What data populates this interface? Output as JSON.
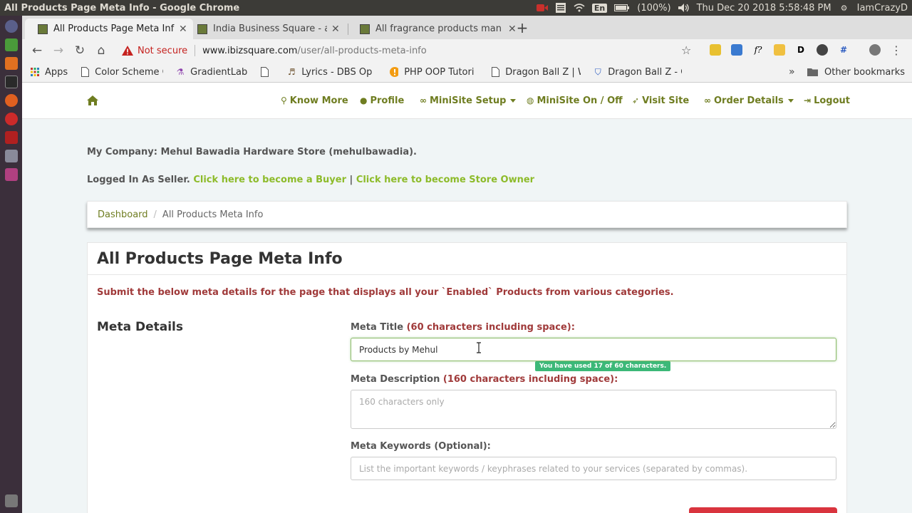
{
  "os_bar": {
    "window_title": "All Products Page Meta Info - Google Chrome",
    "battery": "(100%)",
    "lang": "En",
    "datetime": "Thu Dec 20 2018  5:58:48 PM",
    "user": "IamCrazyD"
  },
  "tabs": [
    {
      "label": "All Products Page Meta Inf",
      "active": true
    },
    {
      "label": "India Business Square - a",
      "active": false
    },
    {
      "label": "All fragrance products man",
      "active": false
    }
  ],
  "address": {
    "security": "Not secure",
    "host": "www.ibizsquare.com",
    "path": "/user/all-products-meta-info"
  },
  "bookmarks": {
    "items": [
      {
        "label": "Apps",
        "icon": "apps-grid-icon"
      },
      {
        "label": "Color Scheme G",
        "icon": "page-icon"
      },
      {
        "label": "GradientLab",
        "icon": "flask-icon"
      },
      {
        "label": "",
        "icon": "page-icon"
      },
      {
        "label": "Lyrics - DBS Op",
        "icon": "lyrics-icon"
      },
      {
        "label": "PHP OOP Tutori",
        "icon": "info-icon"
      },
      {
        "label": "Dragon Ball Z | W",
        "icon": "page-icon"
      },
      {
        "label": "Dragon Ball Z - C",
        "icon": "shield-icon"
      }
    ],
    "more": "»",
    "other": "Other bookmarks"
  },
  "site_nav": {
    "items": [
      {
        "label": "Know More",
        "icon": "lightbulb-icon"
      },
      {
        "label": "Profile",
        "icon": "user-icon"
      },
      {
        "label": "MiniSite Setup",
        "icon": "link-icon",
        "dropdown": true
      },
      {
        "label": "MiniSite On / Off",
        "icon": "globe-icon"
      },
      {
        "label": "Visit Site",
        "icon": "rocket-icon"
      },
      {
        "label": "Order Details",
        "icon": "link-icon",
        "dropdown": true
      },
      {
        "label": "Logout",
        "icon": "sign-out-icon"
      }
    ]
  },
  "company": "My Company: Mehul Bawadia Hardware Store (mehulbawadia).",
  "logged": {
    "prefix": "Logged In As Seller.",
    "buyer_link": "Click here to become a Buyer",
    "separator": "|",
    "owner_link": "Click here to become Store Owner"
  },
  "breadcrumb": {
    "home": "Dashboard",
    "separator": "/",
    "current": "All Products Meta Info"
  },
  "panel": {
    "title": "All Products Page Meta Info",
    "note": "Submit the below meta details for the page that displays all your `Enabled` Products from various categories.",
    "section": "Meta Details",
    "meta_title": {
      "label": "Meta Title",
      "hint": "(60 characters including space):",
      "value": "Products by Mehul",
      "counter": "You have used 17 of 60 characters."
    },
    "meta_description": {
      "label": "Meta Description",
      "hint": "(160 characters including space):",
      "placeholder": "160 characters only"
    },
    "meta_keywords": {
      "label": "Meta Keywords (Optional):",
      "placeholder": "List the important keywords / keyphrases related to your services (separated by commas)."
    }
  },
  "colors": {
    "nav_link": "#6f7d21",
    "link_green": "#8dbb2a",
    "note_red": "#a03a3a",
    "badge_green": "#3cb878",
    "submit_red": "#d9343e"
  }
}
